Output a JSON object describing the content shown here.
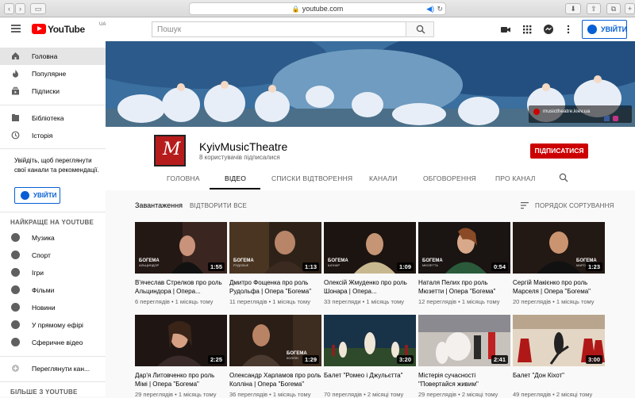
{
  "browser": {
    "url": "youtube.com"
  },
  "header": {
    "logo_text": "YouTube",
    "logo_region": "UA",
    "search_placeholder": "Пошук",
    "signin_label": "УВІЙТИ"
  },
  "sidebar": {
    "items": [
      {
        "label": "Головна",
        "icon": "home-icon"
      },
      {
        "label": "Популярне",
        "icon": "flame-icon"
      },
      {
        "label": "Підписки",
        "icon": "subscriptions-icon"
      },
      {
        "label": "Бібліотека",
        "icon": "library-icon"
      },
      {
        "label": "Історія",
        "icon": "history-icon"
      }
    ],
    "signin_text": "Увійдіть, щоб переглянути свої канали та рекомендації.",
    "signin_label": "УВІЙТИ",
    "best_heading": "НАЙКРАЩЕ НА YOUTUBE",
    "best": [
      {
        "label": "Музика",
        "icon": "music-icon"
      },
      {
        "label": "Спорт",
        "icon": "sport-icon"
      },
      {
        "label": "Ігри",
        "icon": "gaming-icon"
      },
      {
        "label": "Фільми",
        "icon": "movies-icon"
      },
      {
        "label": "Новини",
        "icon": "news-icon"
      },
      {
        "label": "У прямому ефірі",
        "icon": "live-icon"
      },
      {
        "label": "Сферичне відео",
        "icon": "360-icon"
      }
    ],
    "browse_channels": "Переглянути кан...",
    "more_heading": "БІЛЬШЕ З YOUTUBE"
  },
  "banner": {
    "site": "musictheatre.kiev.ua"
  },
  "channel": {
    "name": "KyivMusicTheatre",
    "subscribers": "8 користувачів підписалися",
    "subscribe_label": "ПІДПИСАТИСЯ",
    "tabs": [
      "ГОЛОВНА",
      "ВІДЕО",
      "СПИСКИ ВІДТВОРЕННЯ",
      "КАНАЛИ",
      "ОБГОВОРЕННЯ",
      "ПРО КАНАЛ"
    ],
    "active_tab": "ВІДЕО"
  },
  "uploads": {
    "heading": "Завантаження",
    "play_all": "ВІДТВОРИТИ ВСЕ",
    "sort": "ПОРЯДОК СОРТУВАННЯ"
  },
  "videos": [
    {
      "title": "В'ячеслав Стрелков про роль Альциндора | Опера...",
      "meta": "6 переглядів • 1 місяць тому",
      "duration": "1:55",
      "tag": "БОГЕМА",
      "sub": "АЛЬЦИНДОР"
    },
    {
      "title": "Дмитро Фощенка про роль Рудольфа | Опера \"Богема\"",
      "meta": "11 переглядів • 1 місяць тому",
      "duration": "1:13",
      "tag": "БОГЕМА",
      "sub": "РУДОЛЬФ"
    },
    {
      "title": "Олексій Жмуденко про роль Шонара | Опера...",
      "meta": "33 перегляди • 1 місяць тому",
      "duration": "1:09",
      "tag": "БОГЕМА",
      "sub": "ШОНАР"
    },
    {
      "title": "Наталя Пелих про роль Мюзетти | Опера \"Богема\"",
      "meta": "12 переглядів • 1 місяць тому",
      "duration": "0:54",
      "tag": "БОГЕМА",
      "sub": "МЮЗЕТТА"
    },
    {
      "title": "Сергій Макієнко про роль Марселя | Опера \"Богема\"",
      "meta": "20 переглядів • 1 місяць тому",
      "duration": "1:23",
      "tag": "БОГЕМА",
      "sub": "МАРСЕЛЬ"
    },
    {
      "title": "Дар'я Литовченко про роль Мімі | Опера \"Богема\"",
      "meta": "29 переглядів • 1 місяць тому",
      "duration": "2:25",
      "tag": "",
      "sub": ""
    },
    {
      "title": "Олександр Харламов про роль Колліна | Опера \"Богема\"",
      "meta": "36 переглядів • 1 місяць тому",
      "duration": "1:29",
      "tag": "БОГЕМА",
      "sub": "КОЛЛІН"
    },
    {
      "title": "Балет \"Ромео і Джульєтта\"",
      "meta": "70 переглядів • 2 місяці тому",
      "duration": "3:20",
      "tag": "",
      "sub": ""
    },
    {
      "title": "Містерія сучасності \"Повертайся живим\"",
      "meta": "29 переглядів • 2 місяці тому",
      "duration": "2:41",
      "tag": "",
      "sub": ""
    },
    {
      "title": "Балет \"Дон Кіхот\"",
      "meta": "49 переглядів • 2 місяці тому",
      "duration": "3:00",
      "tag": "",
      "sub": ""
    }
  ]
}
